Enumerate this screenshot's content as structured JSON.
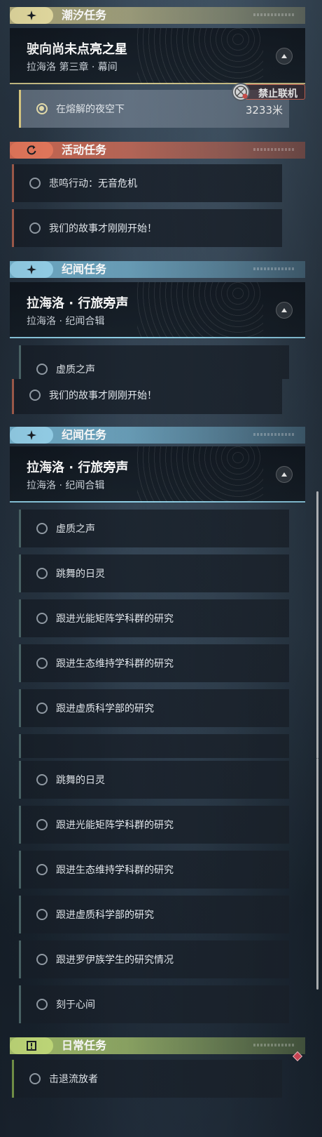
{
  "colors": {
    "tide": "#e9e0a4",
    "event": "#e8755c",
    "companion": "#8fd3ef",
    "daily": "#c5e07c",
    "active_item": "#e8d68a"
  },
  "panel1": {
    "tide_category": {
      "icon": "sparkle-icon",
      "title": "潮汐任务"
    },
    "main_quest": {
      "title": "驶向尚未点亮之星",
      "subtitle": "拉海洛 第三章 · 幕间"
    },
    "active_task": {
      "label": "在熔解的夜空下",
      "ban_label": "禁止联机",
      "distance": "3233米"
    },
    "event_category": {
      "icon": "refresh-icon",
      "title": "活动任务"
    },
    "event_items": [
      {
        "label": "悲鸣行动：无音危机"
      },
      {
        "label": "我们的故事才刚刚开始！"
      }
    ],
    "companion_category": {
      "icon": "sparkle-icon",
      "title": "纪闻任务"
    },
    "companion_quest": {
      "title": "拉海洛 · 行旅旁声",
      "subtitle": "拉海洛 · 纪闻合辑"
    },
    "partial_item": {
      "label": "虚质之声"
    }
  },
  "panel2": {
    "event_item": {
      "label": "我们的故事才刚刚开始！"
    },
    "companion_category": {
      "icon": "sparkle-icon",
      "title": "纪闻任务"
    },
    "companion_quest": {
      "title": "拉海洛 · 行旅旁声",
      "subtitle": "拉海洛 · 纪闻合辑"
    },
    "items": [
      {
        "label": "虚质之声"
      },
      {
        "label": "跳舞的日灵"
      },
      {
        "label": "跟进光能矩阵学科群的研究"
      },
      {
        "label": "跟进生态维持学科群的研究"
      },
      {
        "label": "跟进虚质科学部的研究"
      }
    ]
  },
  "panel3": {
    "items": [
      {
        "label": "跳舞的日灵"
      },
      {
        "label": "跟进光能矩阵学科群的研究"
      },
      {
        "label": "跟进生态维持学科群的研究"
      },
      {
        "label": "跟进虚质科学部的研究"
      },
      {
        "label": "跟进罗伊族学生的研究情况"
      },
      {
        "label": "刻于心间"
      }
    ],
    "daily_category": {
      "icon": "exclamation-icon",
      "title": "日常任务"
    },
    "daily_items": [
      {
        "label": "击退流放者"
      }
    ]
  }
}
